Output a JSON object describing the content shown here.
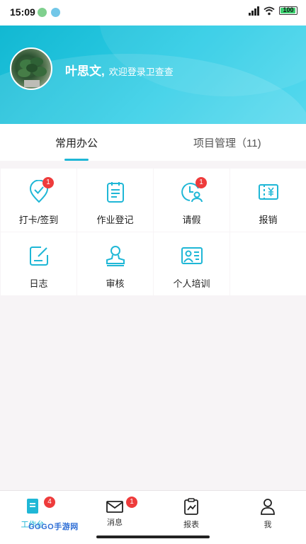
{
  "status": {
    "time": "15:09",
    "battery": "100"
  },
  "header": {
    "user_name": "叶思文,",
    "welcome": "欢迎登录卫查查"
  },
  "tabs": [
    {
      "label": "常用办公"
    },
    {
      "label": "项目管理（11)"
    }
  ],
  "grid": [
    {
      "label": "打卡/签到",
      "icon": "location-check-icon",
      "badge": "1"
    },
    {
      "label": "作业登记",
      "icon": "clipboard-icon",
      "badge": ""
    },
    {
      "label": "请假",
      "icon": "clock-person-icon",
      "badge": "1"
    },
    {
      "label": "报销",
      "icon": "receipt-yen-icon",
      "badge": ""
    },
    {
      "label": "日志",
      "icon": "edit-note-icon",
      "badge": ""
    },
    {
      "label": "审核",
      "icon": "stamp-icon",
      "badge": ""
    },
    {
      "label": "个人培训",
      "icon": "training-icon",
      "badge": ""
    }
  ],
  "bottom_nav": [
    {
      "label": "工作台",
      "icon": "workbench-icon",
      "badge": "4"
    },
    {
      "label": "消息",
      "icon": "mail-icon",
      "badge": "1"
    },
    {
      "label": "报表",
      "icon": "report-icon",
      "badge": ""
    },
    {
      "label": "我",
      "icon": "user-icon",
      "badge": ""
    }
  ],
  "watermark": "GOGO手游网",
  "colors": {
    "accent": "#1fb7d6",
    "header_start": "#12b8d2",
    "badge": "#ee3b3b"
  }
}
